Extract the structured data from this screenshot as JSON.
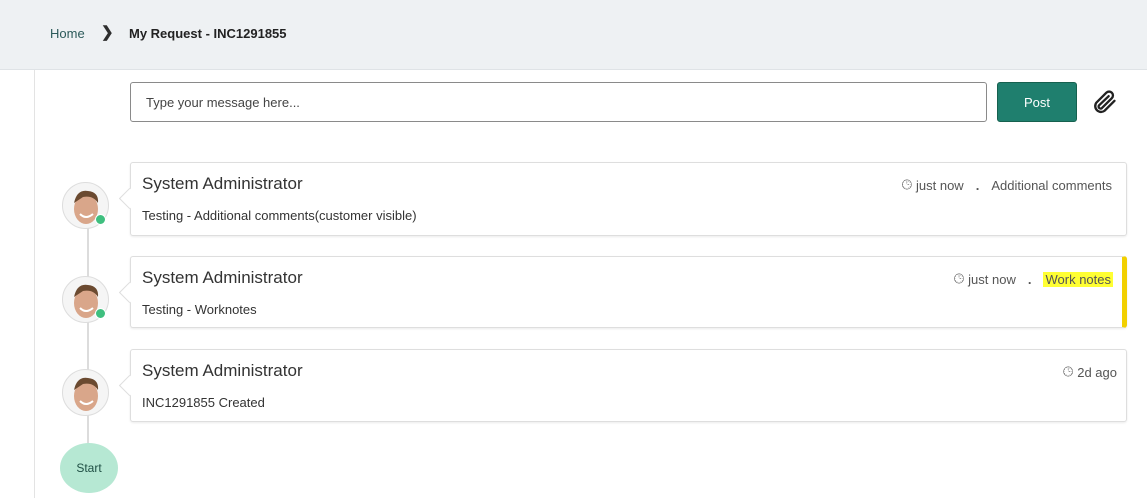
{
  "breadcrumb": {
    "home": "Home",
    "separator": ">",
    "current": "My Request - INC1291855"
  },
  "composer": {
    "placeholder": "Type your message here...",
    "post_label": "Post"
  },
  "entries": [
    {
      "author": "System Administrator",
      "time": "just now",
      "type": "Additional comments",
      "text": "Testing - Additional comments(customer visible)",
      "online": true
    },
    {
      "author": "System Administrator",
      "time": "just now",
      "type": "Work notes",
      "text": "Testing - Worknotes",
      "online": true
    },
    {
      "author": "System Administrator",
      "time": "2d ago",
      "text": "INC1291855 Created",
      "online": false
    }
  ],
  "start_label": "Start",
  "colors": {
    "accent": "#1f7f6e",
    "worknote_bar": "#f2d000",
    "highlight": "#ffff33",
    "online": "#3fbf7f"
  }
}
